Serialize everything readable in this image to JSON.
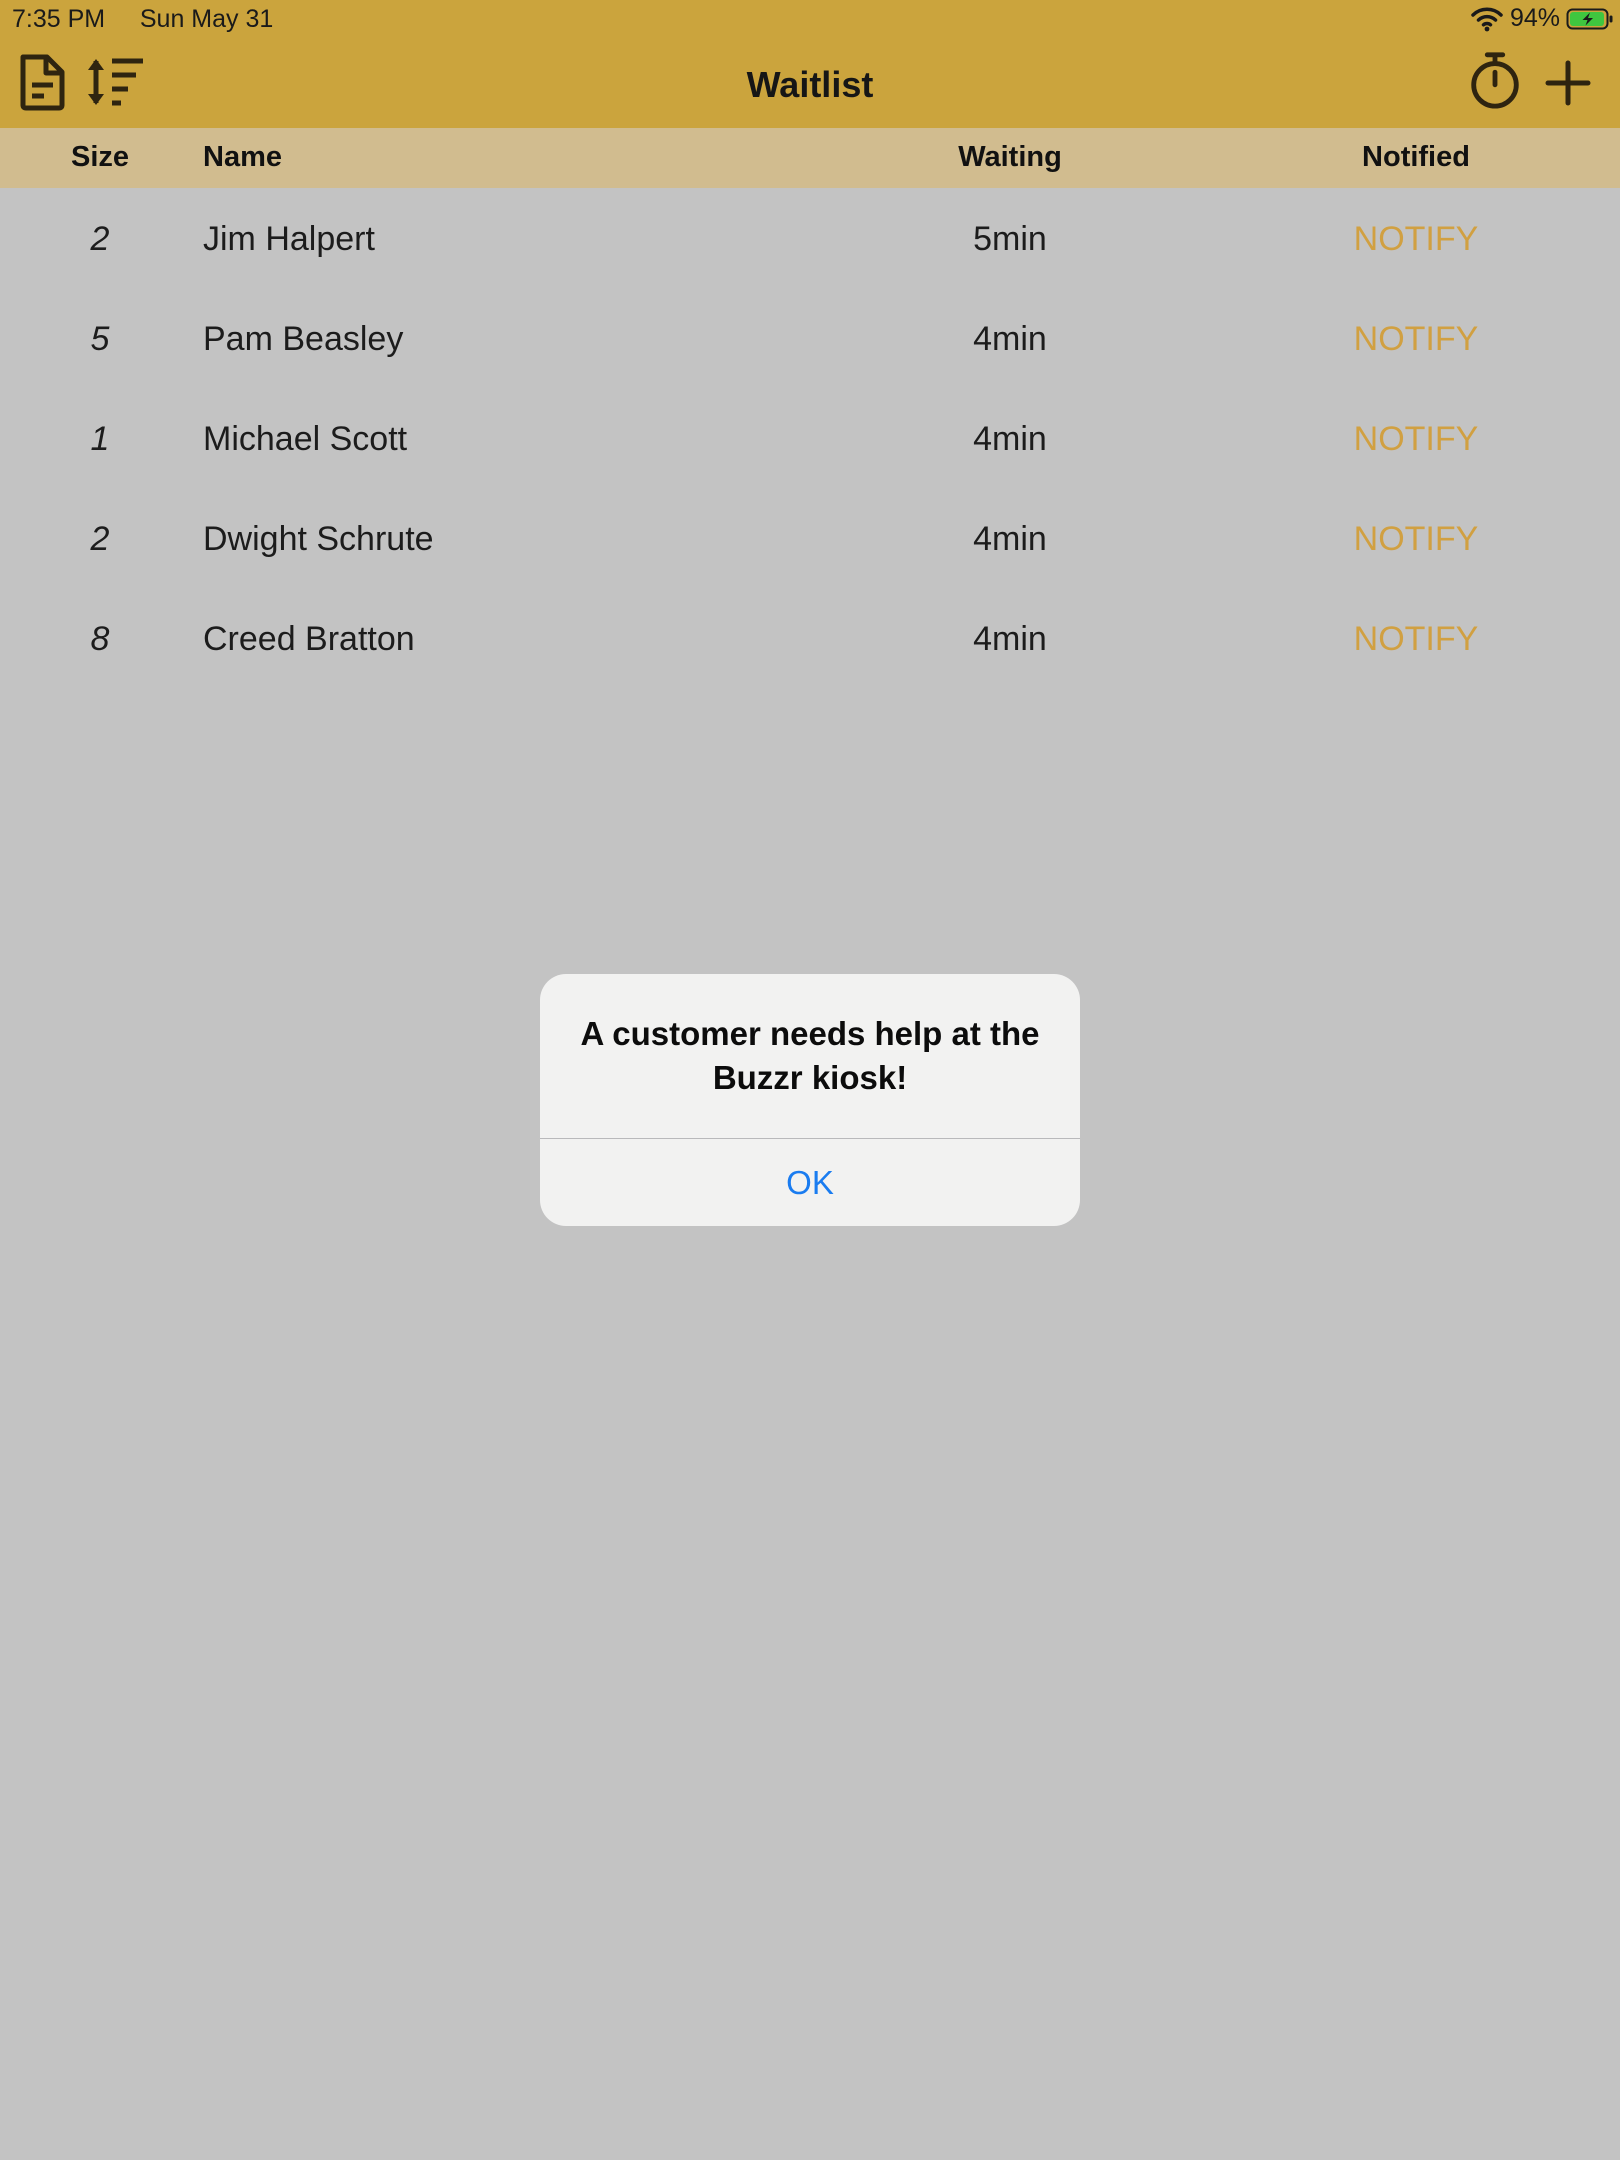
{
  "status_bar": {
    "time": "7:35 PM",
    "date": "Sun May 31",
    "battery_percent": "94%",
    "icons": [
      "wifi-icon",
      "battery-charging-icon"
    ]
  },
  "nav": {
    "title": "Waitlist",
    "left_buttons": [
      "document-icon",
      "sort-icon"
    ],
    "right_buttons": [
      "timer-icon",
      "add-icon"
    ]
  },
  "table": {
    "headers": {
      "size": "Size",
      "name": "Name",
      "waiting": "Waiting",
      "notified": "Notified"
    },
    "rows": [
      {
        "size": "2",
        "name": "Jim Halpert",
        "waiting": "5min",
        "notify": "NOTIFY"
      },
      {
        "size": "5",
        "name": "Pam Beasley",
        "waiting": "4min",
        "notify": "NOTIFY"
      },
      {
        "size": "1",
        "name": "Michael Scott",
        "waiting": "4min",
        "notify": "NOTIFY"
      },
      {
        "size": "2",
        "name": "Dwight Schrute",
        "waiting": "4min",
        "notify": "NOTIFY"
      },
      {
        "size": "8",
        "name": "Creed Bratton",
        "waiting": "4min",
        "notify": "NOTIFY"
      }
    ]
  },
  "alert": {
    "message": "A customer needs help at the Buzzr kiosk!",
    "ok_label": "OK"
  },
  "colors": {
    "nav_bar": "#cba43d",
    "header_row": "#d1bc8f",
    "background_dimmed": "#c3c3c3",
    "notify_text": "#d1a041",
    "alert_button": "#1a7cf0",
    "battery_fill": "#3fc63f"
  }
}
